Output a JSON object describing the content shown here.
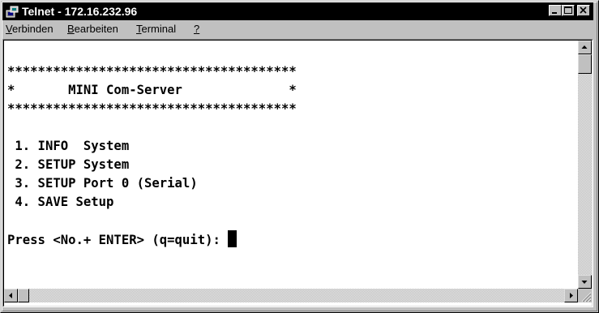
{
  "window": {
    "title": "Telnet - 172.16.232.96",
    "icon": "telnet-terminal-icon",
    "controls": [
      "minimize-icon",
      "maximize-icon",
      "close-icon"
    ]
  },
  "menu": {
    "items": [
      {
        "label": "Verbinden",
        "accel": "V"
      },
      {
        "label": "Bearbeiten",
        "accel": "B"
      },
      {
        "label": "Terminal",
        "accel": "T"
      },
      {
        "label": "?",
        "accel": "?"
      }
    ]
  },
  "terminal": {
    "lines": [
      "",
      "**************************************",
      "*       MINI Com-Server              *",
      "**************************************",
      "",
      " 1. INFO  System",
      " 2. SETUP System",
      " 3. SETUP Port 0 (Serial)",
      " 4. SAVE Setup",
      "",
      "Press <No.+ ENTER> (q=quit): "
    ],
    "cursor": "block-cursor"
  },
  "colors": {
    "titlebar": "#000000",
    "chrome": "#c0c0c0",
    "terminal_bg": "#ffffff",
    "terminal_fg": "#000000"
  }
}
